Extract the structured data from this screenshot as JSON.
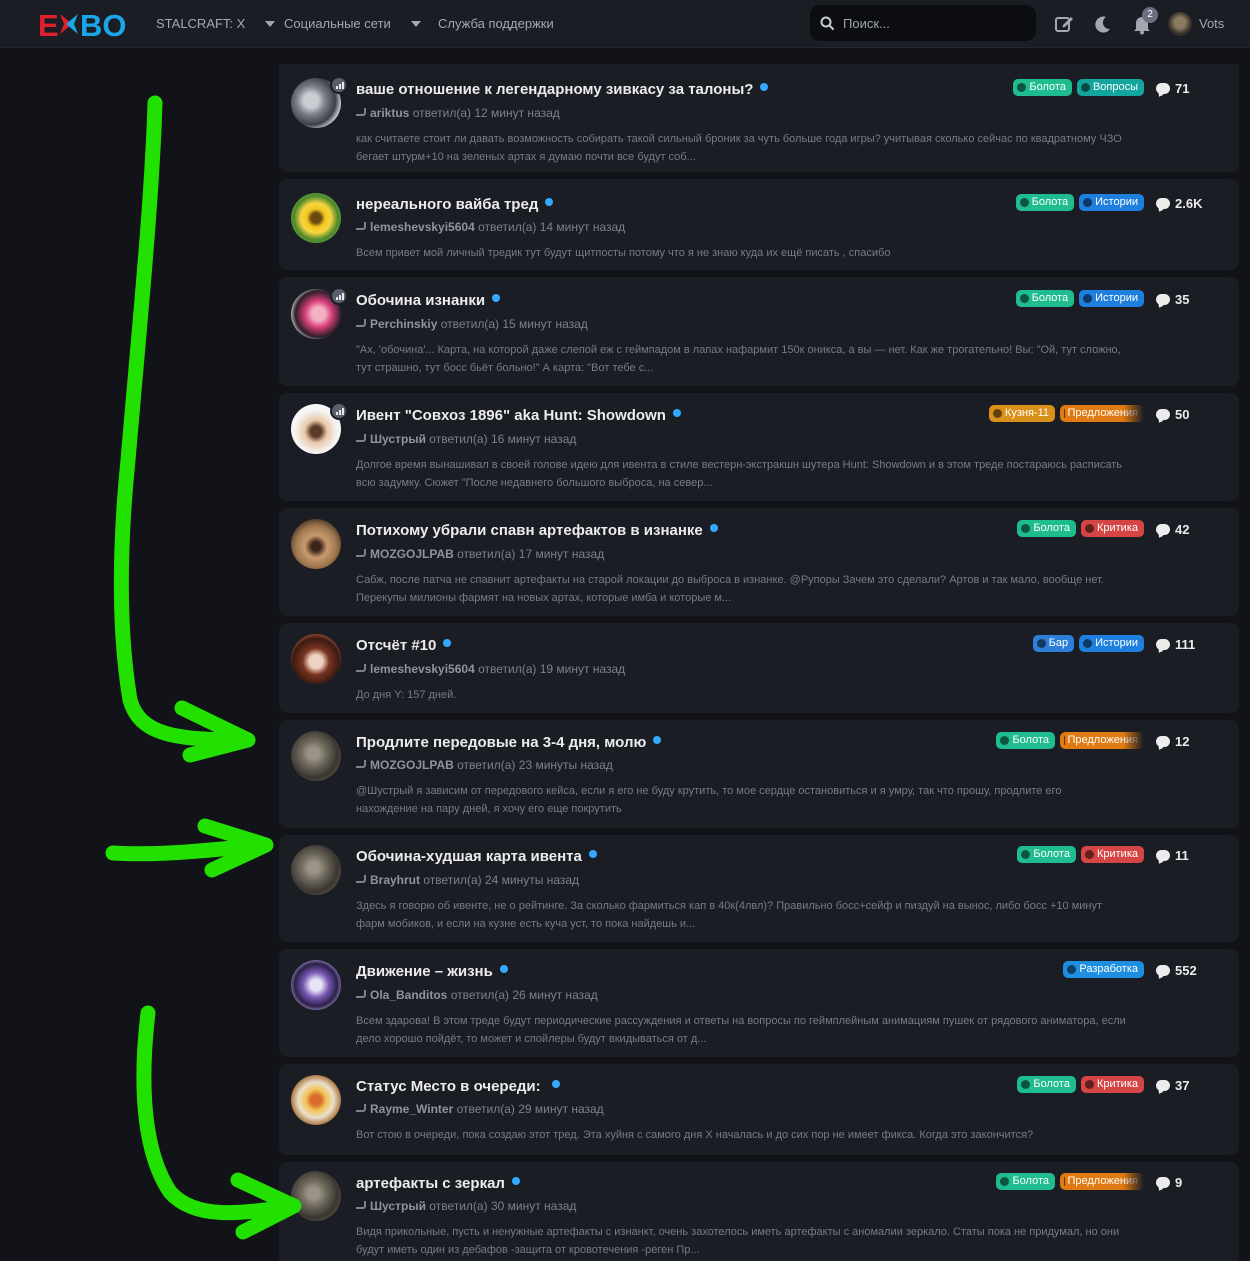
{
  "header": {
    "logo_text": "EXBO",
    "nav": [
      {
        "label": "STALCRAFT: X",
        "dropdown": true
      },
      {
        "label": "Социальные сети",
        "dropdown": true
      },
      {
        "label": "Служба поддержки",
        "dropdown": false
      }
    ],
    "search_placeholder": "Поиск...",
    "notifications_count": "2",
    "username": "Vots"
  },
  "colors": {
    "background": "#111318",
    "card": "#1b1d24",
    "unread_dot": "#33aaff",
    "annotation_arrow": "#22e000"
  },
  "topics": [
    {
      "title": "ваше отношение к легендарному зивкасу за талоны?",
      "author": "ariktus",
      "action": "ответил(а)",
      "time": "12 минут назад",
      "excerpt": "как считаете стоит ли давать возможность собирать такой сильный броник за чуть больше года игры? учитывая сколько сейчас по квадратному ЧЗО бегает штурм+10 на зеленых артах я думаю почти все будут соб...",
      "tags": [
        {
          "label": "Болота",
          "icon": "swamp-icon"
        },
        {
          "label": "Вопросы",
          "icon": "question-icon"
        }
      ],
      "replies": "71"
    },
    {
      "title": "нереального вайба тред",
      "author": "lemeshevskyi5604",
      "action": "ответил(а)",
      "time": "14 минут назад",
      "excerpt": "Всем привет мой личный тредик тут будут щитпосты потому что я не знаю куда их ещё писать , спасибо",
      "tags": [
        {
          "label": "Болота",
          "icon": "swamp-icon"
        },
        {
          "label": "Истории",
          "icon": "fire-icon"
        }
      ],
      "replies": "2.6K"
    },
    {
      "title": "Обочина изнанки",
      "author": "Perchinskiy",
      "action": "ответил(а)",
      "time": "15 минут назад",
      "excerpt": "\"Ах, 'обочина'... Карта, на которой даже слепой еж с геймпадом в лапах нафармит 150к оникса, а вы — нет. Как же трогательно! Вы: \"Ой, тут сложно, тут страшно, тут босс бьёт больно!\" А карта: \"Вот тебе с...",
      "tags": [
        {
          "label": "Болота",
          "icon": "swamp-icon"
        },
        {
          "label": "Истории",
          "icon": "fire-icon"
        }
      ],
      "replies": "35"
    },
    {
      "title": "Ивент \"Совхоз 1896\" aka Hunt: Showdown",
      "author": "Шустрый",
      "action": "ответил(а)",
      "time": "16 минут назад",
      "excerpt": "Долгое время вынашивал в своей голове идею для ивента в стиле вестерн-экстракшн шутера Hunt: Showdown и в этом треде постараюсь расписать всю задумку. Сюжет \"После недавнего большого выброса, на север...",
      "tags": [
        {
          "label": "Кузня-11",
          "icon": "skull-icon"
        },
        {
          "label": "Предложения",
          "icon": "bulb-icon"
        }
      ],
      "replies": "50"
    },
    {
      "title": "Потихому убрали спавн артефактов в изнанке",
      "author": "MOZGOJLPAB",
      "action": "ответил(а)",
      "time": "17 минут назад",
      "excerpt": "Сабж, после патча не спавнит артефакты на старой локации до выброса в изнанке. @Рупоры Зачем это сделали? Артов и так мало, вообще нет. Перекупы милионы фармят на новых артах, которые имба и которые м...",
      "tags": [
        {
          "label": "Болота",
          "icon": "swamp-icon"
        },
        {
          "label": "Критика",
          "icon": "angry-icon"
        }
      ],
      "replies": "42"
    },
    {
      "title": "Отсчёт #10",
      "author": "lemeshevskyi5604",
      "action": "ответил(а)",
      "time": "19 минут назад",
      "excerpt": "До дня Y: 157 дней.",
      "tags": [
        {
          "label": "Бар",
          "icon": "radiation-icon"
        },
        {
          "label": "Истории",
          "icon": "fire-icon"
        }
      ],
      "replies": "111"
    },
    {
      "title": "Продлите передовые на 3-4 дня, молю",
      "author": "MOZGOJLPAB",
      "action": "ответил(а)",
      "time": "23 минуты назад",
      "excerpt": "@Шустрый я зависим от передового кейса, если я его не буду крутить, то мое сердце остановиться и я умру, так что прошу, продлите его нахождение на пару дней, я хочу его еще покрутить",
      "tags": [
        {
          "label": "Болота",
          "icon": "swamp-icon"
        },
        {
          "label": "Предложения",
          "icon": "bulb-icon"
        }
      ],
      "replies": "12"
    },
    {
      "title": "Обочина-худшая карта ивента",
      "author": "Brayhrut",
      "action": "ответил(а)",
      "time": "24 минуты назад",
      "excerpt": "Здесь я говорю об ивенте, не о рейтинге. За сколько фармиться кап в 40к(4лвл)? Правильно босс+сейф и пиздуй на вынос, либо босс +10 минут фарм мобиков, и если на кузне есть куча уст, то пока найдешь и...",
      "tags": [
        {
          "label": "Болота",
          "icon": "swamp-icon"
        },
        {
          "label": "Критика",
          "icon": "angry-icon"
        }
      ],
      "replies": "11"
    },
    {
      "title": "Движение – жизнь",
      "author": "Ola_Banditos",
      "action": "ответил(а)",
      "time": "26 минут назад",
      "excerpt": "Всем здарова! В этом треде будут периодические рассуждения и ответы на вопросы по геймплейным анимациям пушек от рядового аниматора, если дело хорошо пойдёт, то может и спойлеры будут вкидываться от д...",
      "tags": [
        {
          "label": "Разработка",
          "icon": "code-icon"
        }
      ],
      "replies": "552"
    },
    {
      "title": "Статус Место в очереди: ",
      "author": "Rayme_Winter",
      "action": "ответил(а)",
      "time": "29 минут назад",
      "excerpt": "Вот стою в очереди, пока создаю этот тред. Эта хуйня с самого дня X началась и до сих пор не имеет фикса. Когда это закончится?",
      "tags": [
        {
          "label": "Болота",
          "icon": "swamp-icon"
        },
        {
          "label": "Критика",
          "icon": "angry-icon"
        }
      ],
      "replies": "37"
    },
    {
      "title": "артефакты с зеркал",
      "author": "Шустрый",
      "action": "ответил(а)",
      "time": "30 минут назад",
      "excerpt": "Видя прикольные, пусть и ненужные артефакты с изнанкт, очень захотелось иметь артефакты с аномалии зеркало. Статы пока не придумал, но они будут иметь один из дебафов -защита от кровотечения -реген Пр...",
      "tags": [
        {
          "label": "Болота",
          "icon": "swamp-icon"
        },
        {
          "label": "Предложения",
          "icon": "bulb-icon"
        }
      ],
      "replies": "9"
    }
  ]
}
